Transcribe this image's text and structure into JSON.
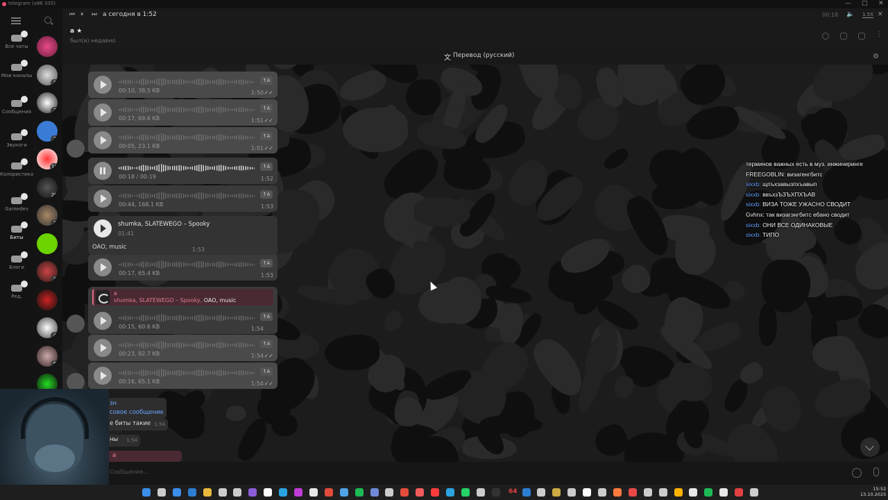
{
  "window": {
    "app_title": "telegram (x86 335)"
  },
  "folders": {
    "items": [
      {
        "label": "Все чаты",
        "active": false
      },
      {
        "label": "Мои каналы",
        "active": false
      },
      {
        "label": "Сообщения",
        "active": false
      },
      {
        "label": "Звукоги",
        "active": false
      },
      {
        "label": "Колористика",
        "active": false
      },
      {
        "label": "Gamedev",
        "active": false
      },
      {
        "label": "Биты",
        "active": true
      },
      {
        "label": "Блоги",
        "active": false
      },
      {
        "label": "Ред.",
        "active": false
      }
    ]
  },
  "chatlist": {
    "badges": [
      "",
      "1",
      "2",
      "2",
      "10",
      "28",
      "1",
      "",
      "1",
      "",
      "4",
      "5",
      ""
    ]
  },
  "player": {
    "title": "а сегодня в 1:52",
    "time": "00:18",
    "speed": "1.5X"
  },
  "header": {
    "peer_name": "а ★",
    "peer_status": "был(а) недавно"
  },
  "translate": {
    "label": "Перевод (русский)"
  },
  "messages": [
    {
      "meta": "00:10, 38.5 KB",
      "time": "1:50",
      "ticks": "✓✓",
      "out": true,
      "playing": false
    },
    {
      "meta": "00:17, 69.6 KB",
      "time": "1:51",
      "ticks": "✓✓",
      "out": true,
      "playing": false
    },
    {
      "meta": "00:05, 23.1 KB",
      "time": "1:51",
      "ticks": "✓✓",
      "out": true,
      "playing": false
    },
    {
      "meta": "00:18 / 00:19",
      "time": "1:52",
      "ticks": "",
      "out": false,
      "playing": true
    },
    {
      "meta": "00:44, 168.1 KB",
      "time": "1:53",
      "ticks": "",
      "out": false,
      "playing": false
    },
    {
      "meta": "00:17, 65.4 KB",
      "time": "1:53",
      "ticks": "",
      "out": false,
      "playing": false
    },
    {
      "meta": "00:23, 92.7 KB",
      "time": "1:54",
      "ticks": "✓✓",
      "out": true,
      "playing": false
    },
    {
      "meta": "00:16, 65.1 KB",
      "time": "1:54",
      "ticks": "✓✓",
      "out": true,
      "playing": false
    }
  ],
  "translate_button": "↑A",
  "music": {
    "title": "shumka, SLATEWEGO – Spooky",
    "duration": "01:41",
    "caption": "OAO, music",
    "time": "1:53"
  },
  "reply": {
    "quote_name": "а",
    "quote_text": "shumka, SLATEWEGO – Spooky,",
    "quote_extra": " OAO, music",
    "meta": "00:15, 60.6 KB",
    "time": "1:54"
  },
  "bottom_bubbles": [
    {
      "text": "зн",
      "color": "#6aa3ff"
    },
    {
      "text": "совое сообщение",
      "color": "#6aa3ff"
    },
    {
      "text": "е биты такие",
      "time": "1:54"
    },
    {
      "text": "ны",
      "time": "1:54"
    },
    {
      "text": "а",
      "color": "#f07f95"
    }
  ],
  "stream_chat": [
    {
      "nick": "",
      "text": "терминов важных есть в муз. инжиниринге",
      "nick_color": "white"
    },
    {
      "nick": "FREEGOBLIN:",
      "text": " визагенгбитс",
      "nick_color": "white"
    },
    {
      "nick": "sixxb:",
      "text": " щпъхзавызпхъавып",
      "nick_color": "blue"
    },
    {
      "nick": "sixxb:",
      "text": " ввъхзЪЗЪХПХЪАВ",
      "nick_color": "blue"
    },
    {
      "nick": "sixxb:",
      "text": " ВИЗА ТОЖЕ УЖАСНО СВОДИТ",
      "nick_color": "blue"
    },
    {
      "nick": "Gvhnx:",
      "text": " так визагэнгбитс ебано сводит",
      "nick_color": "white"
    },
    {
      "nick": "sixxb:",
      "text": " ОНИ ВСЕ ОДИНАКОВЫЕ",
      "nick_color": "blue"
    },
    {
      "nick": "sixxb:",
      "text": " ТИПО",
      "nick_color": "blue"
    }
  ],
  "compose": {
    "placeholder": "Сообщение..."
  },
  "taskbar": {
    "clock_time": "15:52",
    "clock_date": "13.10.2025",
    "counter": "64",
    "icon_colors": [
      "#3b8eea",
      "#cccccc",
      "#3b8eea",
      "#2d7dd2",
      "#e8b93b",
      "#cccccc",
      "#cccccc",
      "#8a5cd6",
      "#ffffff",
      "#2aa3e0",
      "#c03cd6",
      "#e8e8e8",
      "#e34b3b",
      "#4fa3e6",
      "#1db954",
      "#7289da",
      "#cccccc",
      "#e34b3b",
      "#f05a5a",
      "#ff3b3b",
      "#2aa3e0",
      "#25d366",
      "#cccccc",
      "#333333",
      "#e04040",
      "#2d7dd2",
      "#cccccc",
      "#ccaa44",
      "#cccccc",
      "#ffffff",
      "#cccccc",
      "#ff7a3d",
      "#e84848",
      "#cccccc",
      "#cccccc",
      "#ffb300",
      "#e8e8e8",
      "#1db954",
      "#e8e8e8",
      "#e04040",
      "#cccccc"
    ]
  }
}
